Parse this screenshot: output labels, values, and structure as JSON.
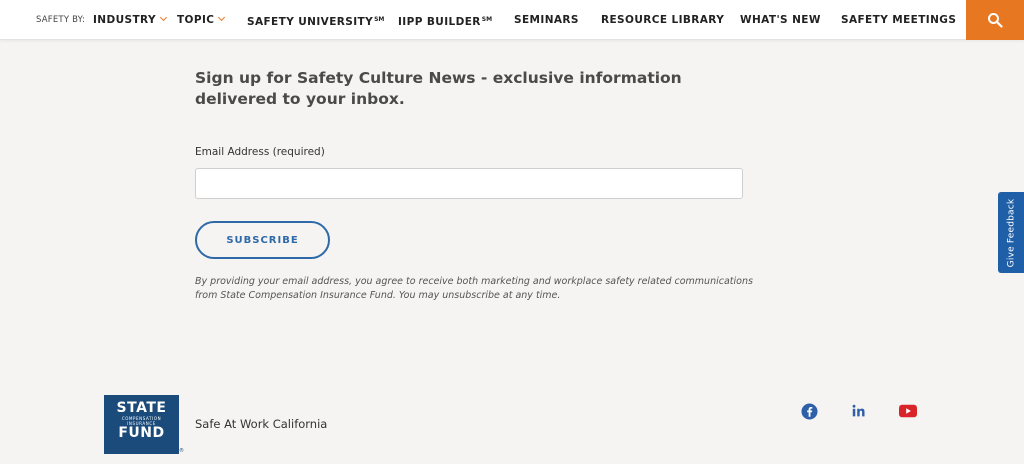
{
  "nav": {
    "safety_by": "SAFETY BY:",
    "items": [
      {
        "label": "INDUSTRY",
        "dropdown": true
      },
      {
        "label": "TOPIC",
        "dropdown": true
      },
      {
        "label": "SAFETY UNIVERSITY",
        "sup": "SM"
      },
      {
        "label": "IIPP BUILDER",
        "sup": "SM"
      },
      {
        "label": "SEMINARS"
      },
      {
        "label": "RESOURCE LIBRARY"
      },
      {
        "label": "WHAT'S NEW"
      },
      {
        "label": "SAFETY MEETINGS"
      }
    ],
    "search_icon": "search-icon"
  },
  "signup": {
    "headline": "Sign up for Safety Culture News - exclusive information delivered to your inbox.",
    "email_label": "Email Address (required)",
    "email_value": "",
    "subscribe_label": "SUBSCRIBE",
    "disclaimer": "By providing your email address, you agree to receive both marketing and workplace safety related communications from State Compensation Insurance Fund. You may unsubscribe at any time."
  },
  "feedback": {
    "label": "Give Feedback"
  },
  "footer": {
    "logo_line1": "STATE",
    "logo_line2": "COMPENSATION",
    "logo_line3": "INSURANCE",
    "logo_line4": "FUND",
    "logo_reg": "®",
    "tagline": "Safe At Work California",
    "social": [
      "facebook-icon",
      "linkedin-icon",
      "youtube-icon"
    ]
  },
  "colors": {
    "accent": "#e87722",
    "brand_blue": "#1b4b7a",
    "link_blue": "#2e6aa8",
    "youtube_red": "#d9252a"
  }
}
